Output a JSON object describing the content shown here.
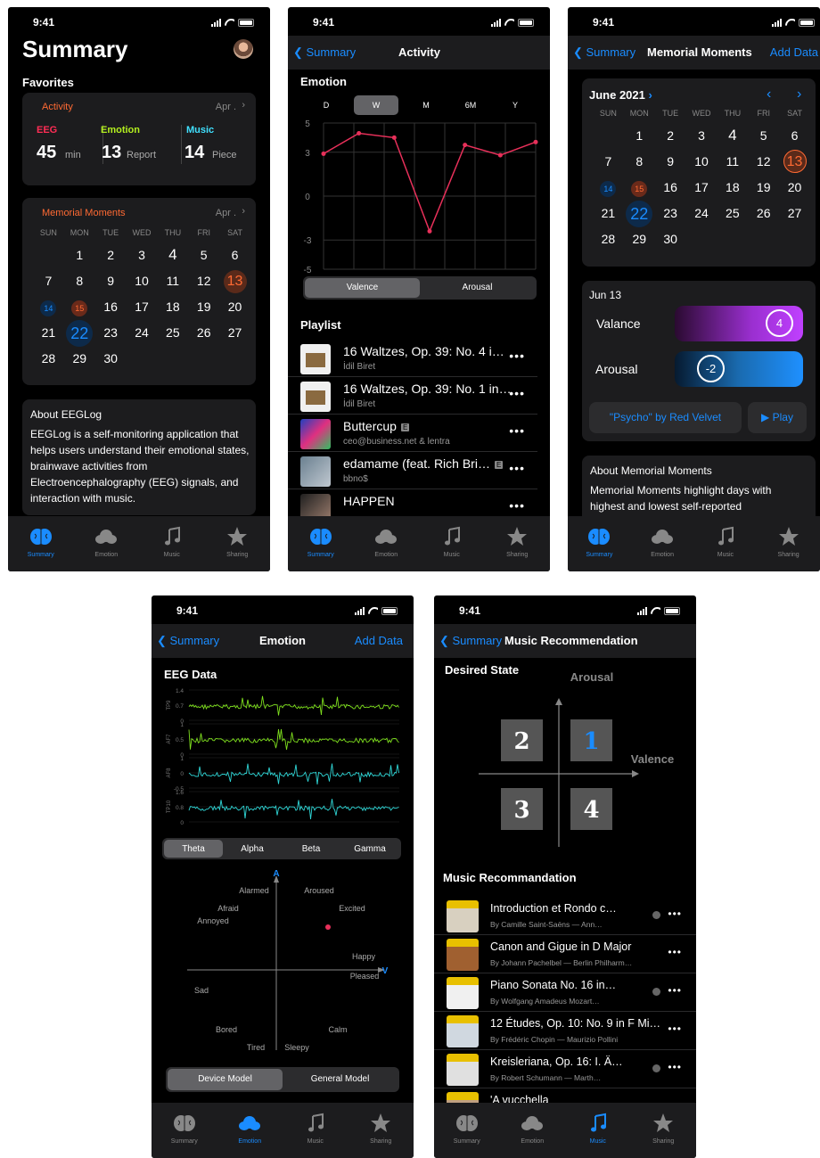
{
  "status": {
    "time": "9:41"
  },
  "tabs": [
    "Summary",
    "Emotion",
    "Music",
    "Sharing"
  ],
  "summary": {
    "title": "Summary",
    "favorites": "Favorites",
    "activity": {
      "title": "Activity",
      "month": "Apr .",
      "eeg_label": "EEG",
      "eeg_value": "45",
      "eeg_unit": "min",
      "emotion_label": "Emotion",
      "emotion_value": "13",
      "emotion_unit": "Report",
      "music_label": "Music",
      "music_value": "14",
      "music_unit": "Piece"
    },
    "moments": {
      "title": "Memorial Moments",
      "month": "Apr ."
    },
    "weekdays": [
      "SUN",
      "MON",
      "TUE",
      "WED",
      "THU",
      "FRI",
      "SAT"
    ],
    "about_title": "About EEGLog",
    "about_text": "EEGLog is a self-monitoring application that helps users understand their emotional states, brainwave activities from Electroencephalography (EEG) signals, and interaction with music."
  },
  "activity": {
    "back": "Summary",
    "title": "Activity",
    "section": "Emotion",
    "ranges": [
      "D",
      "W",
      "M",
      "6M",
      "Y"
    ],
    "selected_range": "W",
    "modes": [
      "Valence",
      "Arousal"
    ],
    "selected_mode": "Valence",
    "chart_data": {
      "type": "line",
      "title": "",
      "ylim": [
        -5,
        5
      ],
      "yticks": [
        "5",
        "3",
        "0",
        "-3",
        "-5"
      ],
      "values": [
        2.9,
        4.3,
        4.0,
        -2.4,
        3.5,
        2.8,
        3.7
      ]
    },
    "playlist_title": "Playlist",
    "playlist": [
      {
        "title": "16 Waltzes, Op. 39: No. 4 i…",
        "sub": "İdil Biret",
        "explicit": false
      },
      {
        "title": "16 Waltzes, Op. 39: No. 1 in…",
        "sub": "İdil Biret",
        "explicit": false
      },
      {
        "title": "Buttercup",
        "sub": "ceo@business.net & lentra",
        "explicit": true
      },
      {
        "title": "edamame (feat. Rich Bri…",
        "sub": "bbno$",
        "explicit": true
      },
      {
        "title": "HAPPEN",
        "sub": "",
        "explicit": false
      }
    ]
  },
  "memorial": {
    "back": "Summary",
    "title": "Memorial Moments",
    "add": "Add Data",
    "month": "June 2021",
    "weekdays": [
      "SUN",
      "MON",
      "TUE",
      "WED",
      "THU",
      "FRI",
      "SAT"
    ],
    "date": "Jun 13",
    "valence_label": "Valance",
    "valence_value": "4",
    "arousal_label": "Arousal",
    "arousal_value": "-2",
    "song_button": "\"Psycho\" by Red Velvet",
    "play_button": "▶ Play",
    "about_title": "About Memorial Moments",
    "about_text": "Memorial Moments highlight days with highest and lowest self-reported"
  },
  "emotion": {
    "back": "Summary",
    "title": "Emotion",
    "add": "Add Data",
    "section": "EEG Data",
    "channels": [
      {
        "name": "TP9",
        "ticks": [
          "1.4",
          "0.7",
          "0"
        ]
      },
      {
        "name": "AF7",
        "ticks": [
          "1",
          "0.5",
          "0"
        ]
      },
      {
        "name": "AF8",
        "ticks": [
          "1",
          "0",
          "-0.5"
        ]
      },
      {
        "name": "TP10",
        "ticks": [
          "1.6",
          "0.8",
          "0"
        ]
      }
    ],
    "bands": [
      "Theta",
      "Alpha",
      "Beta",
      "Gamma"
    ],
    "selected_band": "Theta",
    "axis_a": "A",
    "axis_v": "V",
    "emotions": [
      "Alarmed",
      "Aroused",
      "Afraid",
      "Excited",
      "Annoyed",
      "Happy",
      "Pleased",
      "Sad",
      "Bored",
      "Calm",
      "Tired",
      "Sleepy"
    ],
    "models": [
      "Device Model",
      "General Model"
    ],
    "selected_model": "Device Model",
    "colors": {
      "eeg1": "#7fe01e",
      "eeg2": "#2fd6d6"
    }
  },
  "music": {
    "back": "Summary",
    "title": "Music Recommendation",
    "desired": "Desired State",
    "arousal": "Arousal",
    "valence": "Valence",
    "quadrants": [
      "2",
      "1",
      "3",
      "4"
    ],
    "section": "Music Recommandation",
    "list": [
      {
        "title": "Introduction et Rondo c…",
        "sub": "By Camille Saint-Saëns — Ann…"
      },
      {
        "title": "Canon and Gigue in D Major",
        "sub": "By Johann Pachelbel — Berlin Philharm…"
      },
      {
        "title": "Piano Sonata No. 16 in…",
        "sub": "By Wolfgang Amadeus Mozart…"
      },
      {
        "title": "12 Études, Op. 10: No. 9 in F Mi…",
        "sub": "By Frédéric Chopin — Maurizio Pollini"
      },
      {
        "title": "Kreisleriana, Op. 16: I. Ä…",
        "sub": "By Robert Schumann — Marth…"
      },
      {
        "title": "'A vucchella",
        "sub": ""
      }
    ]
  }
}
